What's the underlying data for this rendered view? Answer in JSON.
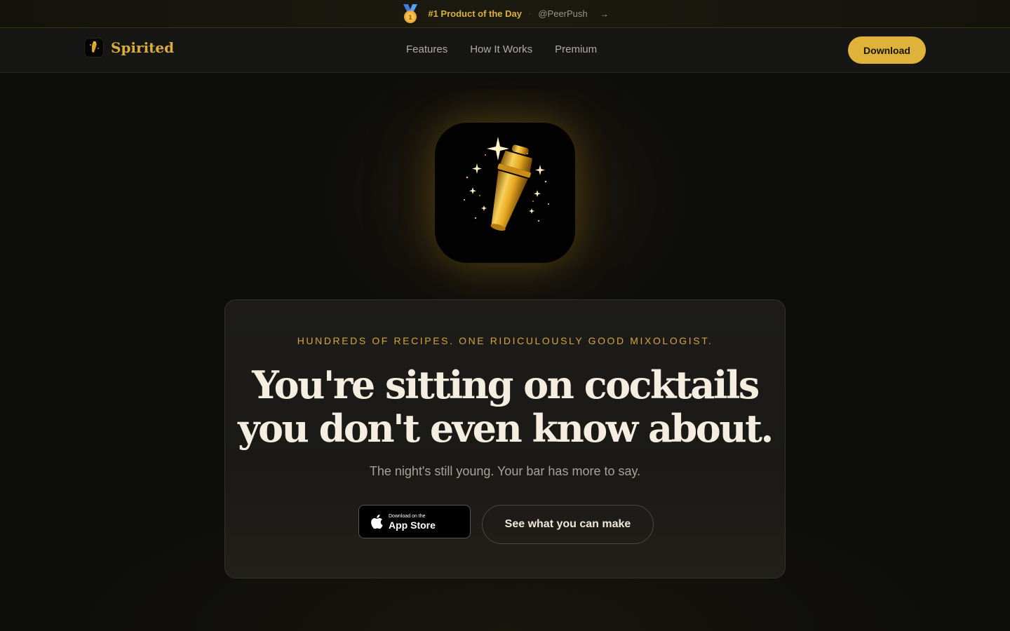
{
  "promo": {
    "title": "#1 Product of the Day",
    "separator": "·",
    "handle": "@PeerPush",
    "arrow": "→",
    "icon": "medal-icon"
  },
  "nav": {
    "brand": "Spirited",
    "brand_icon": "cocktail-shaker-icon",
    "links": [
      "Features",
      "How It Works",
      "Premium"
    ],
    "cta": "Download"
  },
  "hero": {
    "app_icon": "cocktail-shaker-icon",
    "eyebrow": "HUNDREDS OF RECIPES. ONE RIDICULOUSLY GOOD MIXOLOGIST.",
    "headline_line1": "You're sitting on cocktails",
    "headline_line2": "you don't even know about.",
    "subhead": "The night's still young. Your bar has more to say.",
    "appstore_small": "Download on the",
    "appstore_big": "App Store",
    "appstore_icon": "apple-icon",
    "secondary_cta": "See what you can make"
  },
  "colors": {
    "accent_gold": "#dfb33a",
    "background": "#0d0d0c",
    "text_light": "#f4ede0"
  }
}
